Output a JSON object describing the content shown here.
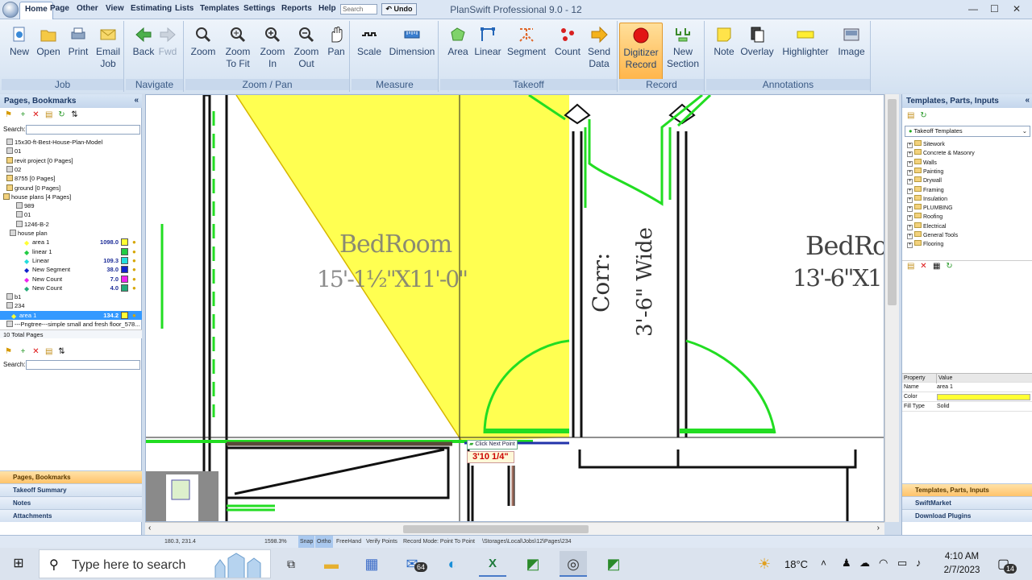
{
  "menubar": {
    "tabs": [
      "Home",
      "Page",
      "Other",
      "View",
      "Estimating",
      "Lists",
      "Templates",
      "Settings",
      "Reports",
      "Help"
    ],
    "search_placeholder": "Search",
    "undo_label": "Undo",
    "app_title": "PlanSwift Professional 9.0 - 12"
  },
  "ribbon": {
    "groups": [
      {
        "label": "Job",
        "buttons": [
          "New",
          "Open",
          "Print",
          "Email\nJob"
        ]
      },
      {
        "label": "Navigate",
        "buttons": [
          "Back",
          "Fwd"
        ]
      },
      {
        "label": "Zoom / Pan",
        "buttons": [
          "Zoom",
          "Zoom\nTo Fit",
          "Zoom\nIn",
          "Zoom\nOut",
          "Pan"
        ]
      },
      {
        "label": "Measure",
        "buttons": [
          "Scale",
          "Dimension"
        ]
      },
      {
        "label": "Takeoff",
        "buttons": [
          "Area",
          "Linear",
          "Segment",
          "Count",
          "Send\nData"
        ]
      },
      {
        "label": "Record",
        "buttons": [
          "Digitizer\nRecord",
          "New\nSection"
        ]
      },
      {
        "label": "Annotations",
        "buttons": [
          "Note",
          "Overlay",
          "Highlighter",
          "Image"
        ]
      }
    ]
  },
  "left_panel": {
    "title": "Pages, Bookmarks",
    "search_label": "Search:",
    "tree": [
      {
        "text": "15x30-ft-Best-House-Plan-Model",
        "kind": "page"
      },
      {
        "text": "01",
        "kind": "page"
      },
      {
        "text": "revit project [0 Pages]",
        "kind": "folder"
      },
      {
        "text": "02",
        "kind": "page"
      },
      {
        "text": "8755 [0 Pages]",
        "kind": "folder"
      },
      {
        "text": "ground [0 Pages]",
        "kind": "folder"
      },
      {
        "text": "house plans [4 Pages]",
        "kind": "folder"
      },
      {
        "text": "989",
        "kind": "page"
      },
      {
        "text": "01",
        "kind": "page"
      },
      {
        "text": "1246-B-2",
        "kind": "page"
      },
      {
        "text": "house plan",
        "kind": "page"
      },
      {
        "text": "area 1",
        "kind": "take",
        "value": "1098.0",
        "color": "#ffff33"
      },
      {
        "text": "linear 1",
        "kind": "take",
        "value": "",
        "color": "#22cc44"
      },
      {
        "text": "Linear",
        "kind": "take",
        "value": "109.3",
        "color": "#22dddd"
      },
      {
        "text": "New Segment",
        "kind": "take",
        "value": "38.0",
        "color": "#1122cc"
      },
      {
        "text": "New Count",
        "kind": "take",
        "value": "7.0",
        "color": "#ee22ee"
      },
      {
        "text": "New Count",
        "kind": "take",
        "value": "4.0",
        "color": "#22aa77"
      },
      {
        "text": "b1",
        "kind": "page"
      },
      {
        "text": "234",
        "kind": "page"
      },
      {
        "text": "area 1",
        "kind": "take",
        "value": "134.2",
        "color": "#ffff33"
      },
      {
        "text": "---Pngtree---simple small and fresh floor_578...",
        "kind": "page"
      }
    ],
    "total_pages": "10 Total Pages",
    "bottom_search_label": "Search:",
    "bottom_tabs": [
      "Pages, Bookmarks",
      "Takeoff Summary",
      "Notes",
      "Attachments"
    ]
  },
  "canvas": {
    "room1_name": "BedRoom",
    "room1_dims": "15'-1½\"X11'-0\"",
    "corr_name": "Corr:",
    "corr_width": "3'-6\" Wide",
    "room2_name": "BedRo",
    "room2_dims": "13'-6\"X1",
    "tooltip": "Click Next Point",
    "measure": "3'10 1/4\"",
    "area_color": "#ffff33",
    "wall_color": "#22dd22"
  },
  "right_panel": {
    "title": "Templates, Parts, Inputs",
    "dropdown_value": "Takeoff Templates",
    "categories": [
      "Sitework",
      "Concrete & Masonry",
      "Walls",
      "Painting",
      "Drywall",
      "Framing",
      "Insulation",
      "PLUMBING",
      "Roofing",
      "Electrical",
      "General Tools",
      "Flooring"
    ],
    "prop_header": [
      "Property",
      "Value"
    ],
    "props": [
      {
        "name": "Name",
        "value": "area 1"
      },
      {
        "name": "Color",
        "value": ""
      },
      {
        "name": "Fill Type",
        "value": "Solid"
      }
    ],
    "bottom_tabs": [
      "Templates, Parts, Inputs",
      "SwiftMarket",
      "Download Plugins"
    ]
  },
  "statusbar": {
    "coords": "180.3, 231.4",
    "zoom": "1598.3%",
    "snap": "Snap",
    "ortho": "Ortho",
    "freehand": "FreeHand",
    "verify": "Verify Points",
    "record_mode": "Record Mode: Point To Point",
    "path": "\\Storages\\Local\\Jobs\\12\\Pages\\234"
  },
  "taskbar": {
    "search_placeholder": "Type here to search",
    "mail_badge": "64",
    "temperature": "18°C",
    "time": "4:10 AM",
    "date": "2/7/2023",
    "notifications": "14"
  }
}
